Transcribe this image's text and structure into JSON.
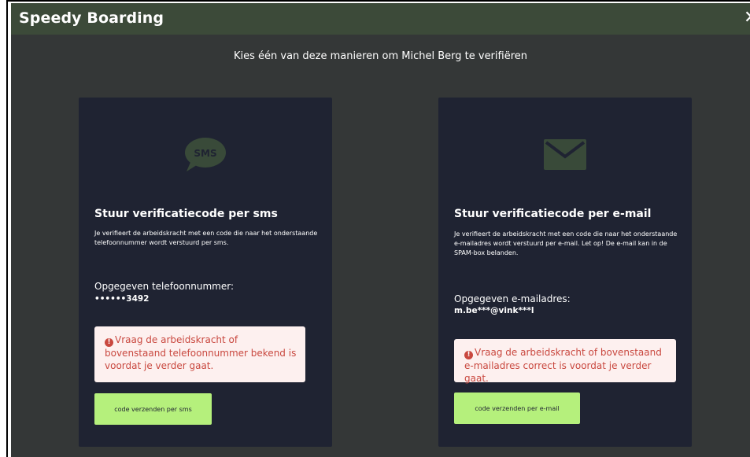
{
  "app": {
    "title": "Speedy Boarding",
    "close_glyph": "✕"
  },
  "instruction": "Kies één van deze manieren om Michel Berg te verifiëren",
  "sms_card": {
    "icon": "sms-bubble-icon",
    "icon_text": "SMS",
    "heading": "Stuur verificatiecode per sms",
    "description": "Je verifieert de arbeidskracht met een code die naar het onderstaande telefoonnummer wordt verstuurd per sms.",
    "field_label": "Opgegeven telefoonnummer:",
    "field_value": "••••••3492",
    "warning": "Vraag de arbeidskracht of bovenstaand telefoonnummer bekend is voordat je verder gaat.",
    "button_label": "code verzenden per sms"
  },
  "email_card": {
    "icon": "envelope-icon",
    "heading": "Stuur verificatiecode per e-mail",
    "description": "Je verifieert de arbeidskracht met een code die naar het onderstaande e-mailadres wordt verstuurd per e-mail. Let op! De e-mail kan in de SPAM-box belanden.",
    "field_label": "Opgegeven e-mailadres:",
    "field_value": "m.be***@vink***l",
    "warning": "Vraag de arbeidskracht of bovenstaand e-mailadres correct is voordat je verder gaat.",
    "button_label": "code verzenden per e-mail"
  },
  "colors": {
    "header": "#3c4a39",
    "backdrop": "#343737",
    "card": "#1f2332",
    "icon": "#394a39",
    "warning_bg": "#fdf0ef",
    "warning_text": "#c9483f",
    "button": "#b5f07c"
  }
}
